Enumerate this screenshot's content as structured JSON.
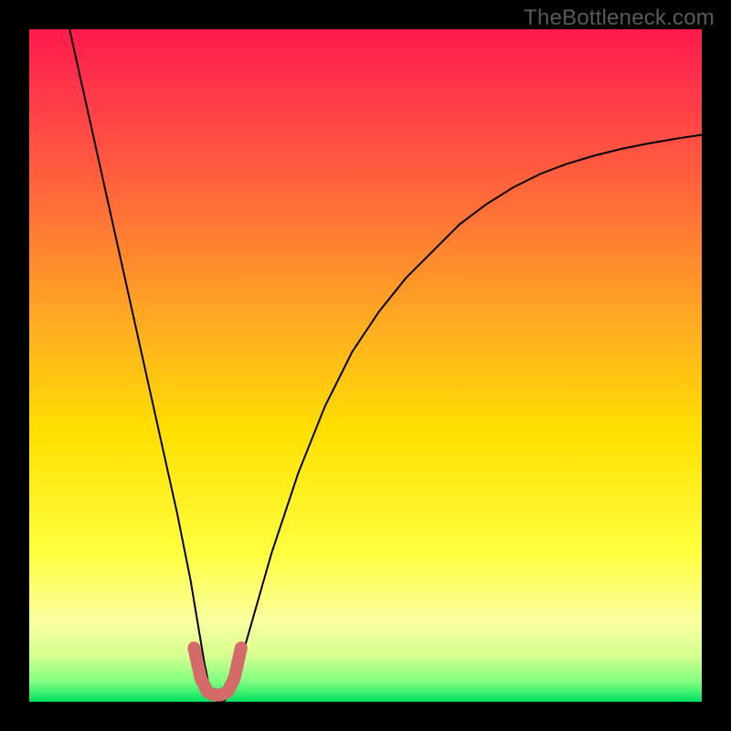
{
  "watermark": "TheBottleneck.com",
  "chart_data": {
    "type": "line",
    "title": "",
    "xlabel": "",
    "ylabel": "",
    "xlim": [
      0,
      100
    ],
    "ylim": [
      0,
      100
    ],
    "gradient_stops": [
      {
        "offset": 0.0,
        "color": "#ff1a4d"
      },
      {
        "offset": 0.1,
        "color": "#ff3a4a"
      },
      {
        "offset": 0.25,
        "color": "#ff6a3a"
      },
      {
        "offset": 0.45,
        "color": "#ffb020"
      },
      {
        "offset": 0.6,
        "color": "#ffe000"
      },
      {
        "offset": 0.78,
        "color": "#ffff40"
      },
      {
        "offset": 0.88,
        "color": "#faffa0"
      },
      {
        "offset": 0.93,
        "color": "#d8ff90"
      },
      {
        "offset": 0.97,
        "color": "#80ff80"
      },
      {
        "offset": 1.0,
        "color": "#00e060"
      }
    ],
    "series": [
      {
        "name": "bottleneck-curve",
        "color": "#000000",
        "stroke_width": 2,
        "x": [
          6,
          8,
          10,
          12,
          14,
          16,
          18,
          20,
          22,
          24,
          25,
          26,
          27,
          28,
          29,
          30,
          32,
          34,
          36,
          38,
          40,
          44,
          48,
          52,
          56,
          60,
          64,
          68,
          72,
          76,
          80,
          84,
          88,
          92,
          96,
          100
        ],
        "y": [
          100,
          91,
          82,
          73,
          64,
          55,
          46,
          37,
          28,
          18,
          12,
          6,
          1,
          0,
          0,
          2,
          8,
          15,
          22,
          28,
          34,
          44,
          52,
          58,
          63,
          67,
          71,
          74,
          76.5,
          78.5,
          80,
          81.2,
          82.2,
          83,
          83.7,
          84.3
        ]
      },
      {
        "name": "optimal-zone-marker",
        "color": "#d46a6a",
        "stroke_width": 14,
        "linecap": "round",
        "x": [
          24.5,
          25.5,
          26.5,
          27.5,
          28.5,
          29.5,
          30.5,
          31.5
        ],
        "y": [
          8,
          3.5,
          1.5,
          1,
          1,
          1.5,
          3.5,
          8
        ]
      }
    ]
  }
}
